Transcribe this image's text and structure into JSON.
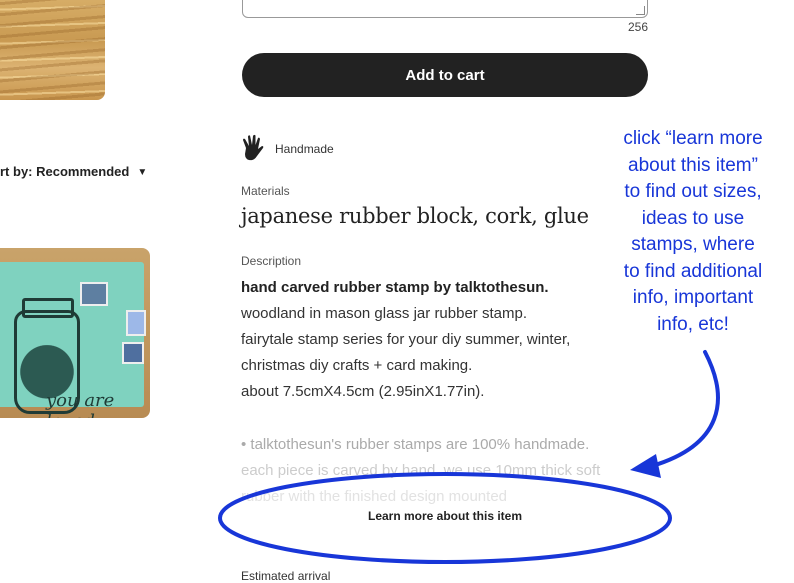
{
  "listing": {
    "personalization": {
      "char_count": "256"
    },
    "add_to_cart_label": "Add to cart",
    "handmade_label": "Handmade",
    "materials": {
      "heading": "Materials",
      "value": "japanese rubber block, cork, glue"
    },
    "description": {
      "heading": "Description",
      "lines": [
        "hand carved rubber stamp by talktothesun.",
        "woodland in mason glass jar rubber stamp.",
        "fairytale stamp series for your diy summer, winter,",
        "christmas diy crafts + card making.",
        "about 7.5cmX4.5cm (2.95inX1.77in).",
        "• talktothesun's rubber stamps are 100% handmade.",
        "each piece is carved by hand. we use 10mm thick soft",
        "rubber with the finished design mounted"
      ]
    },
    "learn_more_label": "Learn more about this item",
    "estimated_arrival_heading": "Estimated arrival"
  },
  "sidebar": {
    "sort_label": "rt by: Recommended",
    "photo_text": "you are loved"
  },
  "annotation": {
    "text": "click “learn more\nabout this item”\nto find out sizes,\nideas to use\nstamps, where\nto find additional\ninfo, important\ninfo, etc!",
    "color": "#1836d8"
  },
  "icons": {
    "handmade": "hand-icon",
    "sort_caret": "caret-down-icon"
  }
}
